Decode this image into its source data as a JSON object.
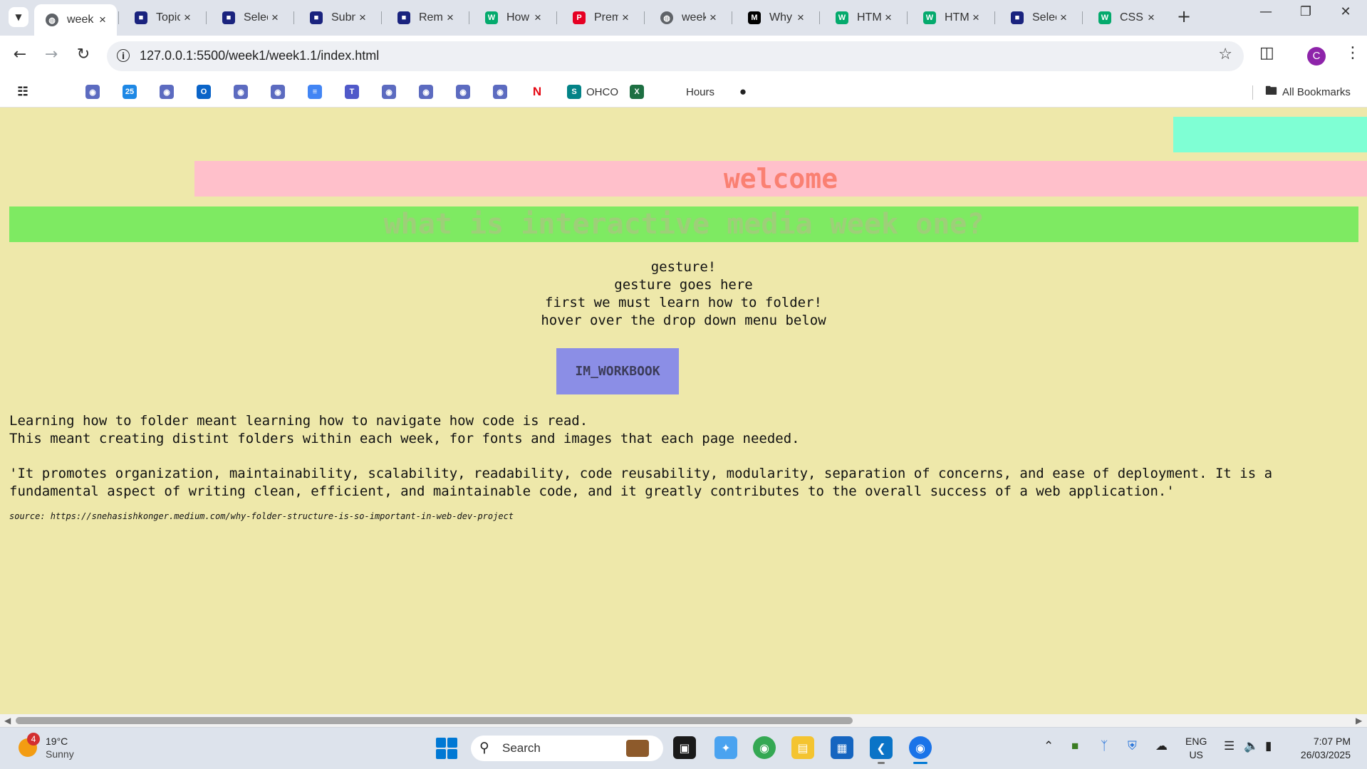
{
  "browser": {
    "tabs": [
      {
        "title": "week",
        "favicon": "globe-icon",
        "active": true
      },
      {
        "title": "Topic",
        "favicon": "brand-icon"
      },
      {
        "title": "Selec",
        "favicon": "brand-icon"
      },
      {
        "title": "Subn",
        "favicon": "brand-icon"
      },
      {
        "title": "Remo",
        "favicon": "brand-icon"
      },
      {
        "title": "How",
        "favicon": "w3-icon"
      },
      {
        "title": "Prem",
        "favicon": "pinterest-icon"
      },
      {
        "title": "week",
        "favicon": "globe-icon"
      },
      {
        "title": "Why",
        "favicon": "medium-icon"
      },
      {
        "title": "HTM",
        "favicon": "w3-icon"
      },
      {
        "title": "HTM",
        "favicon": "w3-icon"
      },
      {
        "title": "Selec",
        "favicon": "brand-icon"
      },
      {
        "title": "CSS",
        "favicon": "w3-icon"
      }
    ],
    "url": "127.0.0.1:5500/week1/week1.1/index.html",
    "profile_initial": "C",
    "bookmarks": [
      {
        "label": "",
        "icon": "apps-grid-icon"
      },
      {
        "label": "",
        "icon": "microsoft-icon"
      },
      {
        "label": "",
        "icon": "bookmark-icon"
      },
      {
        "label": "",
        "icon": "calendar-icon"
      },
      {
        "label": "",
        "icon": "bookmark-icon"
      },
      {
        "label": "",
        "icon": "outlook-icon"
      },
      {
        "label": "",
        "icon": "bookmark-icon"
      },
      {
        "label": "",
        "icon": "bookmark-icon"
      },
      {
        "label": "",
        "icon": "docs-icon"
      },
      {
        "label": "",
        "icon": "teams-icon"
      },
      {
        "label": "",
        "icon": "bookmark-icon"
      },
      {
        "label": "",
        "icon": "bookmark-icon"
      },
      {
        "label": "",
        "icon": "bookmark-icon"
      },
      {
        "label": "",
        "icon": "bookmark-icon"
      },
      {
        "label": "",
        "icon": "netflix-icon"
      },
      {
        "label": "OHCO",
        "icon": "sharepoint-icon"
      },
      {
        "label": "",
        "icon": "excel-icon"
      },
      {
        "label": "Hours",
        "icon": "microsoft-icon"
      },
      {
        "label": "",
        "icon": "github-icon"
      }
    ],
    "all_bookmarks_label": "All Bookmarks"
  },
  "page": {
    "welcome": "welcome",
    "heading": "what is interactive media week one?",
    "center_lines": [
      "gesture!",
      "gesture goes here",
      "first we must learn how to folder!",
      "hover over the drop down menu below"
    ],
    "dropdown_label": "IM_WORKBOOK",
    "paragraph1": [
      "Learning how to folder meant learning how to navigate how code is read.",
      "This meant creating distint folders within each week, for fonts and images that each page needed."
    ],
    "quote": [
      "'It promotes organization, maintainability, scalability, readability, code reusability, modularity, separation of concerns, and ease of deployment. It is a",
      "fundamental aspect of writing clean, efficient, and maintainable code, and it greatly contributes to the overall success of a web application.'"
    ],
    "source": "source: https://snehasishkonger.medium.com/why-folder-structure-is-so-important-in-web-dev-project"
  },
  "taskbar": {
    "weather_temp": "19°C",
    "weather_desc": "Sunny",
    "weather_badge": "4",
    "search_label": "Search",
    "lang_line1": "ENG",
    "lang_line2": "US",
    "time": "7:07 PM",
    "date": "26/03/2025"
  },
  "colors": {
    "page_bg": "#eee8aa",
    "aqua_box": "#7fffd4",
    "welcome_bg": "#ffc0cb",
    "welcome_text": "#fa8072",
    "heading_bg": "#7eea62",
    "dropdown_bg": "#8b8ee6"
  }
}
